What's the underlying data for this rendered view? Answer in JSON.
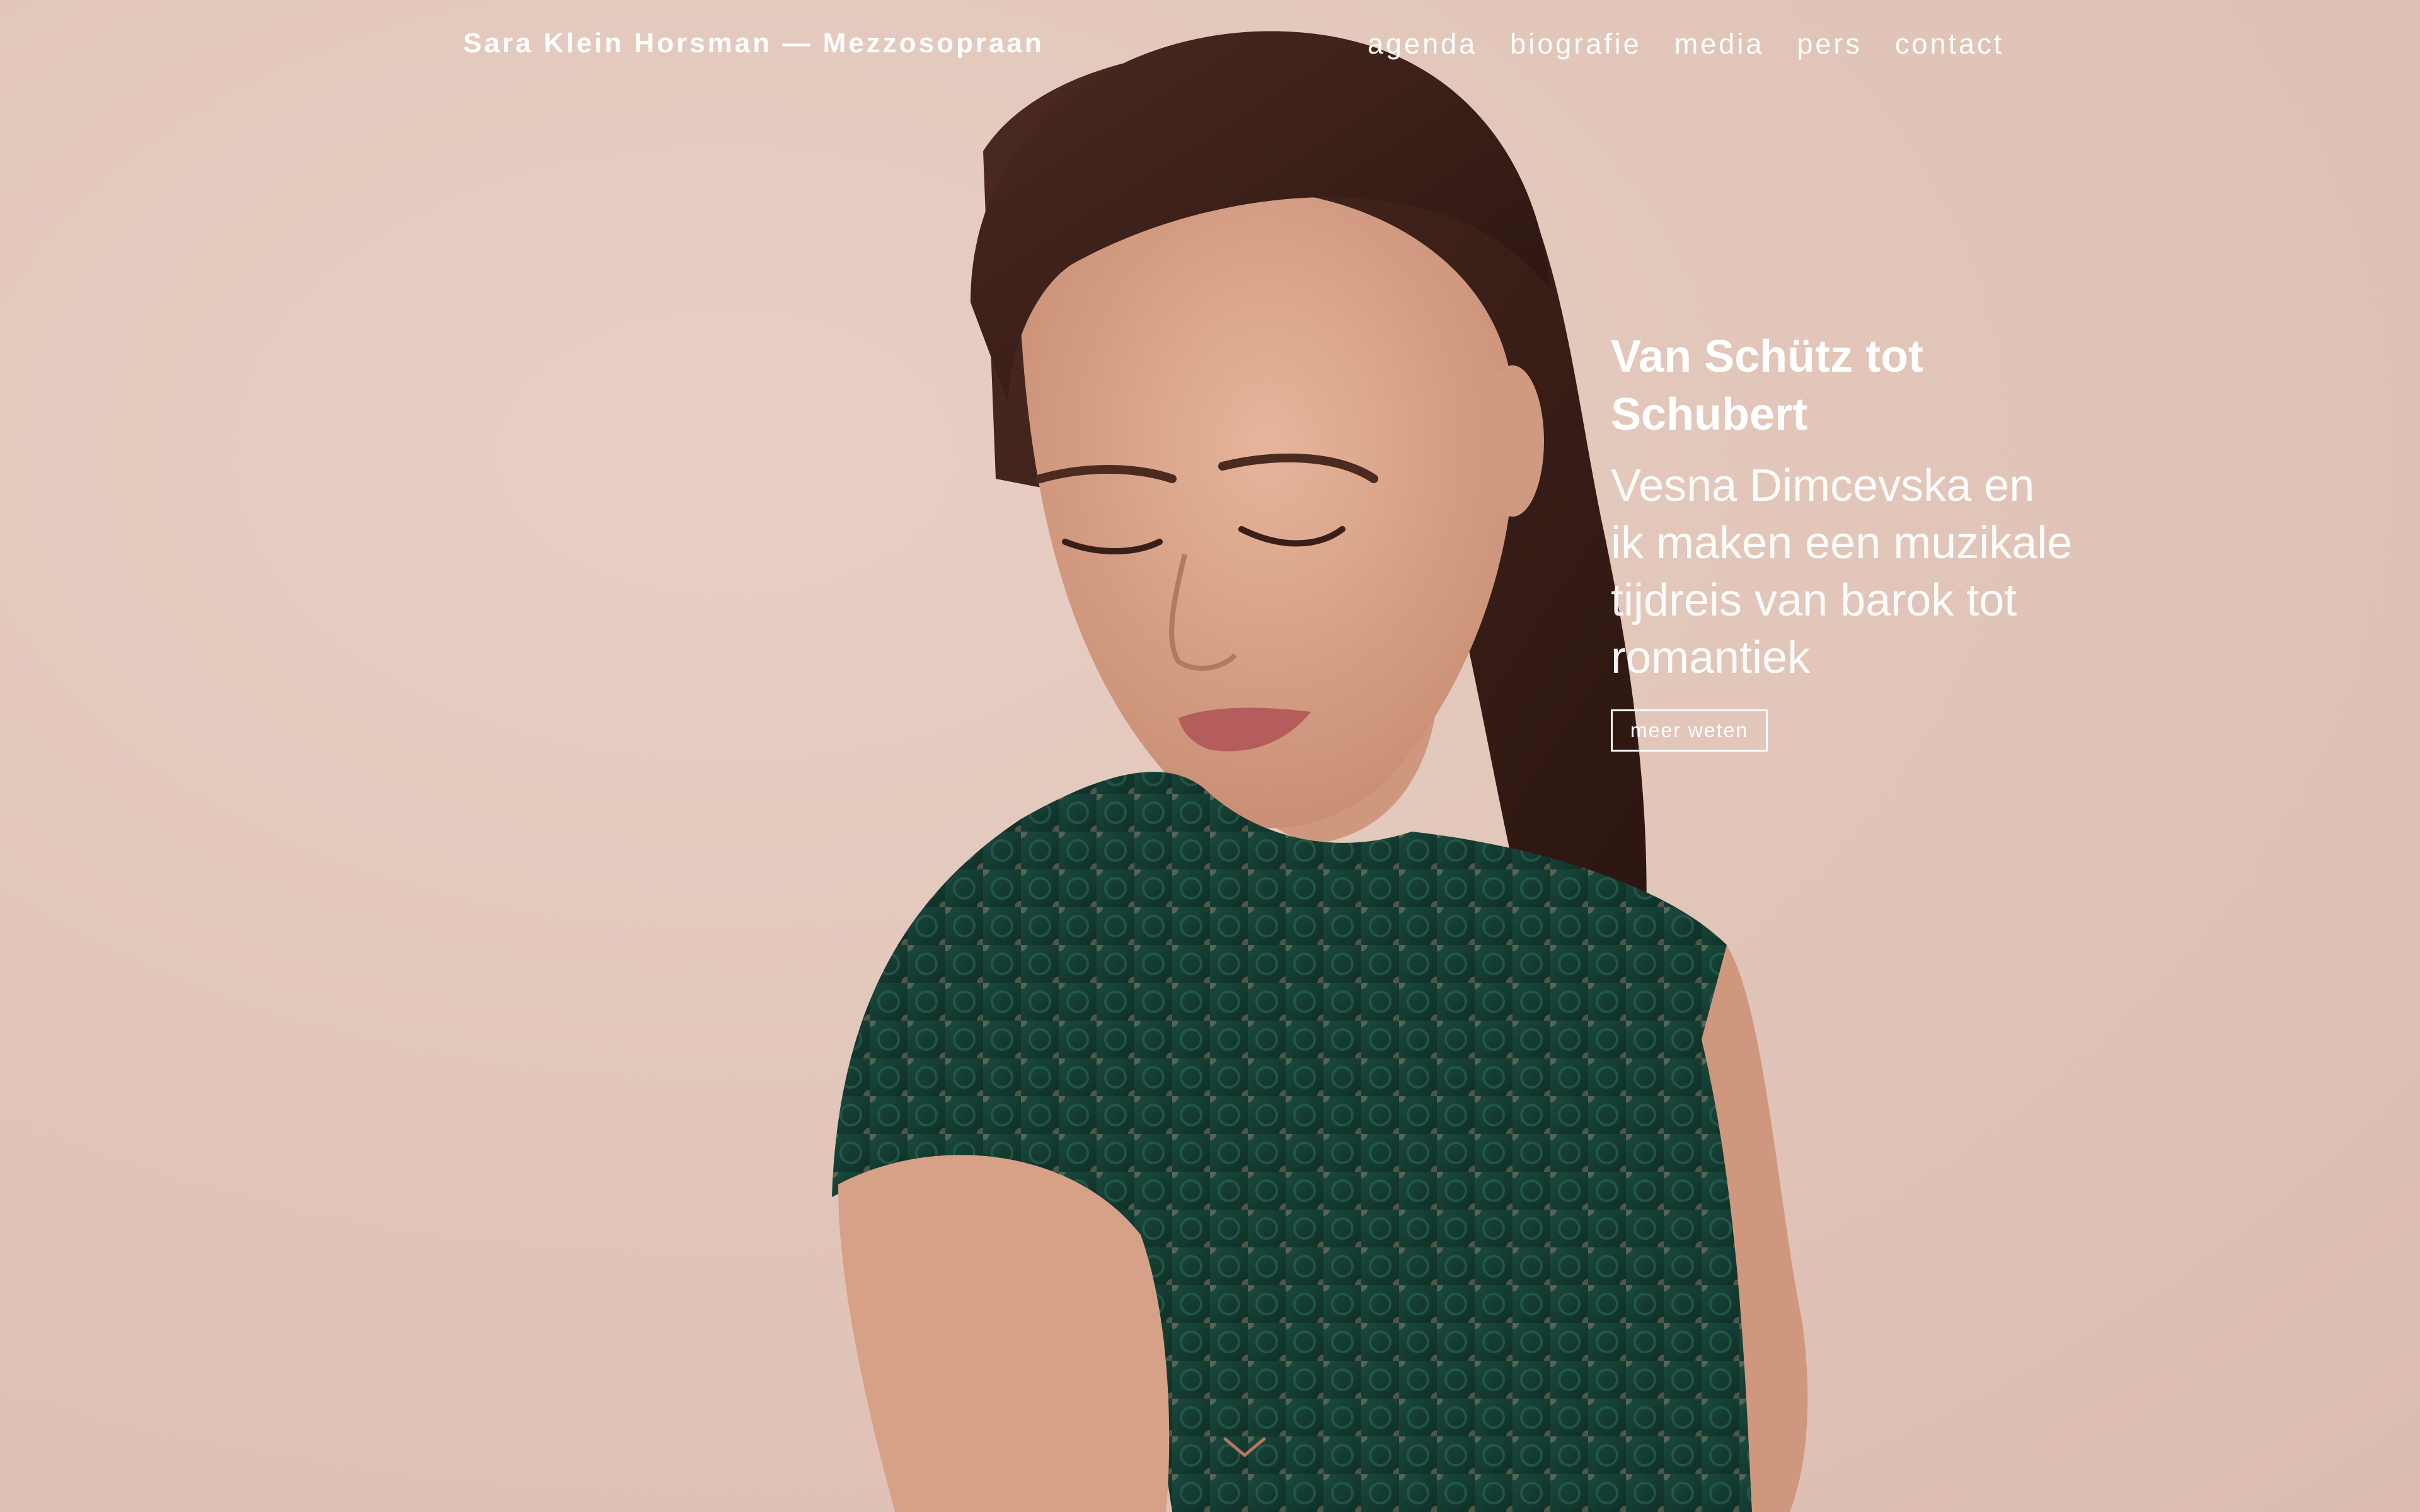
{
  "header": {
    "site_title": "Sara Klein Horsman — Mezzosopraan"
  },
  "nav": {
    "items": [
      {
        "label": "agenda"
      },
      {
        "label": "biografie"
      },
      {
        "label": "media"
      },
      {
        "label": "pers"
      },
      {
        "label": "contact"
      }
    ]
  },
  "feature": {
    "title": "Van Schütz tot Schubert",
    "subtitle": "Vesna Dimcevska en ik maken een muzikale tijdreis van barok tot romantiek",
    "button_label": "meer weten"
  },
  "colors": {
    "background": "#e2c6ba",
    "dress": "#123a30",
    "hair": "#3a2019",
    "skin": "#d9a58c",
    "text": "#ffffff"
  },
  "icons": {
    "scroll": "chevron-down-icon"
  }
}
